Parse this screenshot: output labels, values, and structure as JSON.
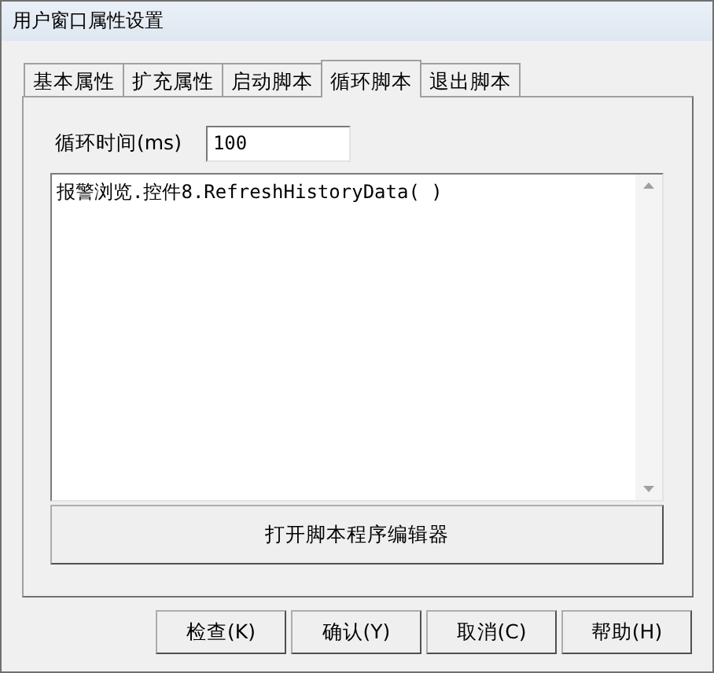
{
  "window": {
    "title": "用户窗口属性设置"
  },
  "tabs": [
    {
      "label": "基本属性",
      "selected": false
    },
    {
      "label": "扩充属性",
      "selected": false
    },
    {
      "label": "启动脚本",
      "selected": false
    },
    {
      "label": "循环脚本",
      "selected": true
    },
    {
      "label": "退出脚本",
      "selected": false
    }
  ],
  "loop_time": {
    "label": "循环时间(ms)",
    "value": "100"
  },
  "script_editor": {
    "value": "报警浏览.控件8.RefreshHistoryData( )"
  },
  "open_editor_button": "打开脚本程序编辑器",
  "buttons": [
    "检查(K)",
    "确认(Y)",
    "取消(C)",
    "帮助(H)"
  ]
}
